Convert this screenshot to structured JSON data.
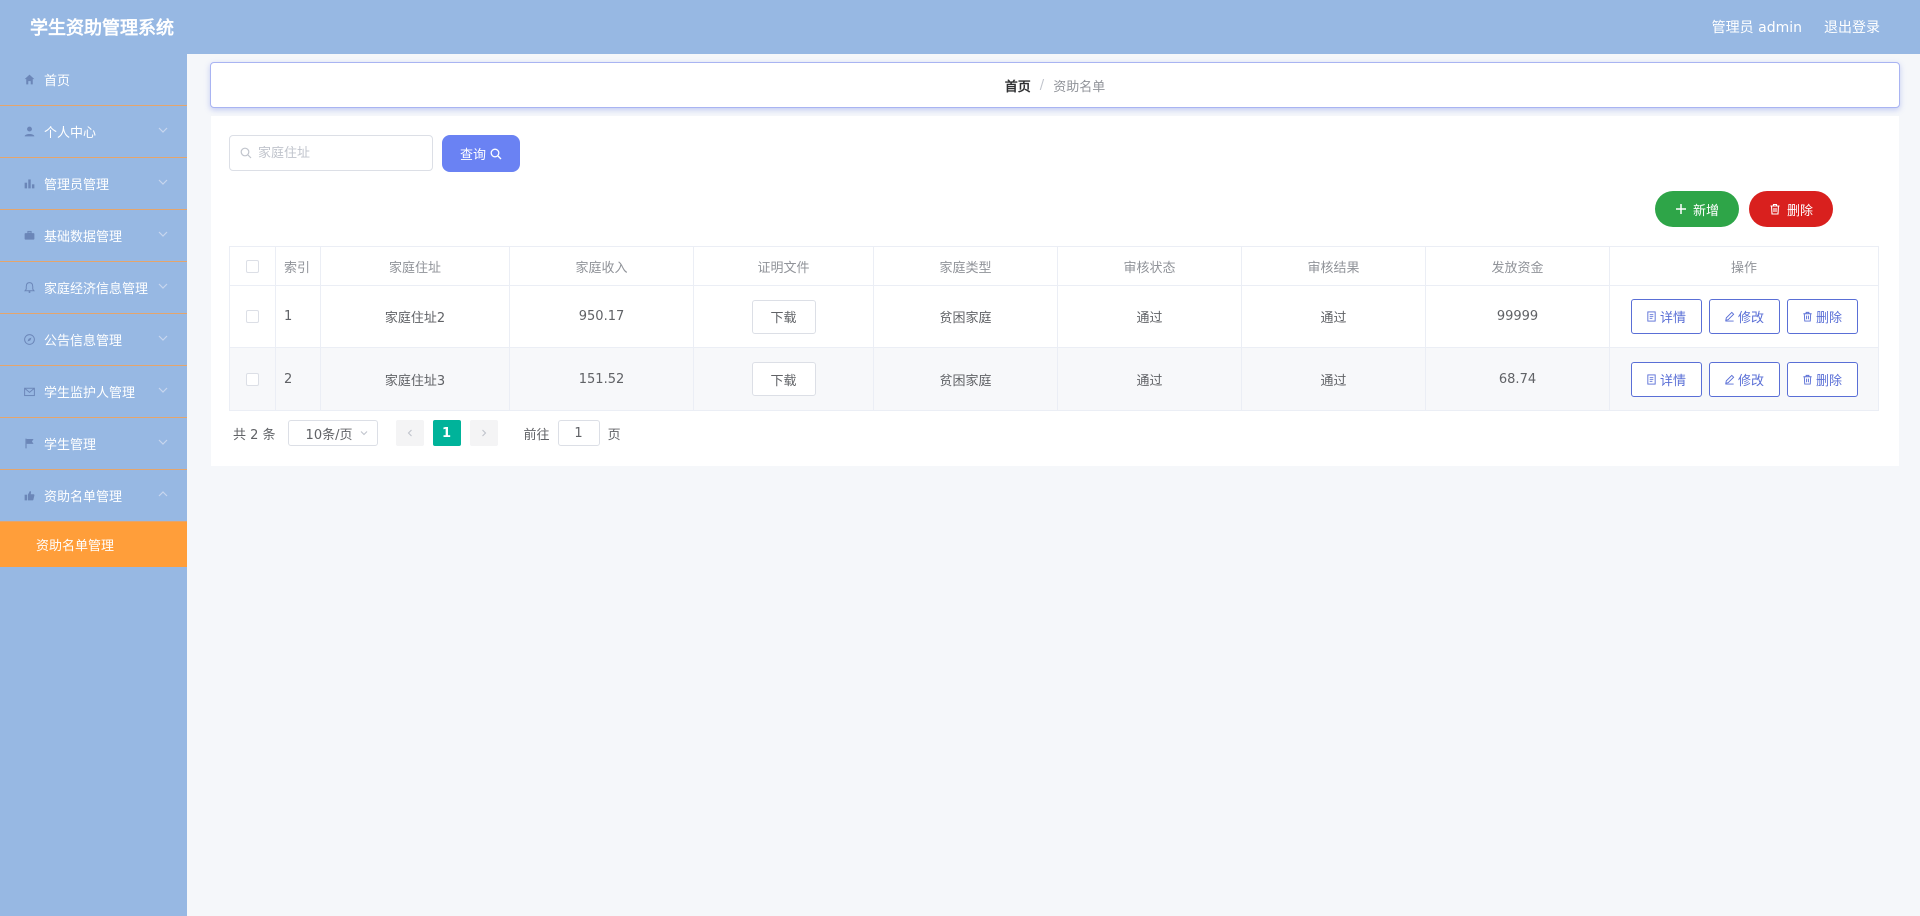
{
  "header": {
    "title": "学生资助管理系统",
    "user_label": "管理员 admin",
    "logout_label": "退出登录"
  },
  "sidebar": {
    "items": [
      {
        "label": "首页",
        "icon": "home-icon"
      },
      {
        "label": "个人中心",
        "icon": "user-icon"
      },
      {
        "label": "管理员管理",
        "icon": "bar-chart-icon"
      },
      {
        "label": "基础数据管理",
        "icon": "briefcase-icon"
      },
      {
        "label": "家庭经济信息管理",
        "icon": "bell-icon"
      },
      {
        "label": "公告信息管理",
        "icon": "compass-icon"
      },
      {
        "label": "学生监护人管理",
        "icon": "mail-icon"
      },
      {
        "label": "学生管理",
        "icon": "flag-icon"
      },
      {
        "label": "资助名单管理",
        "icon": "thumb-up-icon"
      }
    ],
    "submenu_active": "资助名单管理"
  },
  "breadcrumb": {
    "home": "首页",
    "separator": "/",
    "current": "资助名单"
  },
  "search": {
    "placeholder": "家庭住址",
    "value": "",
    "query_label": "查询"
  },
  "actions": {
    "add_label": "新增",
    "delete_label": "删除"
  },
  "table": {
    "columns": [
      "索引",
      "家庭住址",
      "家庭收入",
      "证明文件",
      "家庭类型",
      "审核状态",
      "审核结果",
      "发放资金",
      "操作"
    ],
    "rows": [
      {
        "index": "1",
        "address": "家庭住址2",
        "income": "950.17",
        "file": "下载",
        "type": "贫困家庭",
        "status": "通过",
        "result": "通过",
        "fund": "99999"
      },
      {
        "index": "2",
        "address": "家庭住址3",
        "income": "151.52",
        "file": "下载",
        "type": "贫困家庭",
        "status": "通过",
        "result": "通过",
        "fund": "68.74"
      }
    ],
    "row_actions": {
      "detail": "详情",
      "edit": "修改",
      "delete": "删除"
    }
  },
  "pagination": {
    "total": "共 2 条",
    "page_size": "10条/页",
    "current_page": "1",
    "goto_label": "前往",
    "goto_value": "1",
    "page_suffix": "页"
  },
  "colors": {
    "header_bg": "#97b8e3",
    "sidebar_active": "#ff9e3a",
    "primary": "#6a82f3",
    "success": "#2ea548",
    "danger": "#d9201e",
    "page_active": "#00b39a"
  }
}
